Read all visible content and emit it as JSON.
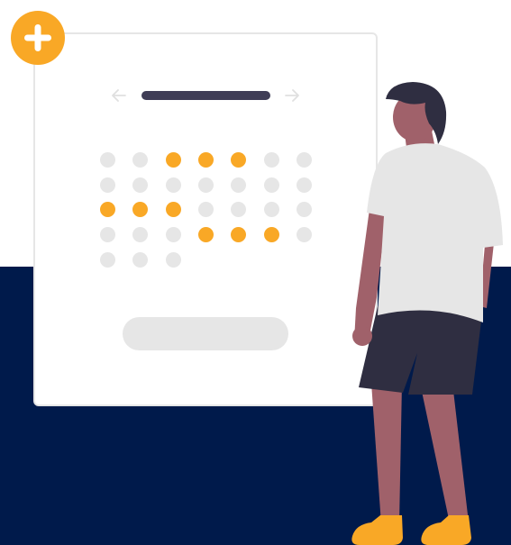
{
  "colors": {
    "background": "#ffffff",
    "navy_band": "#001a4b",
    "accent": "#f9a826",
    "placeholder_gray": "#e6e6e6",
    "card_border": "#e6e6e6",
    "title_bar": "#3f3d56",
    "arrow": "#e0e0e0",
    "skin": "#a0616a",
    "hair": "#2f2e41",
    "shirt": "#e6e6e6",
    "shorts": "#2f2e41",
    "shoes": "#f9a826"
  },
  "icons": {
    "add": "plus-icon",
    "prev": "arrow-left-icon",
    "next": "arrow-right-icon"
  },
  "calendar": {
    "columns": 7,
    "days": [
      false,
      false,
      true,
      true,
      true,
      false,
      false,
      false,
      false,
      false,
      false,
      false,
      false,
      false,
      true,
      true,
      true,
      false,
      false,
      false,
      false,
      false,
      false,
      false,
      true,
      true,
      true,
      false,
      false,
      false,
      false
    ]
  }
}
